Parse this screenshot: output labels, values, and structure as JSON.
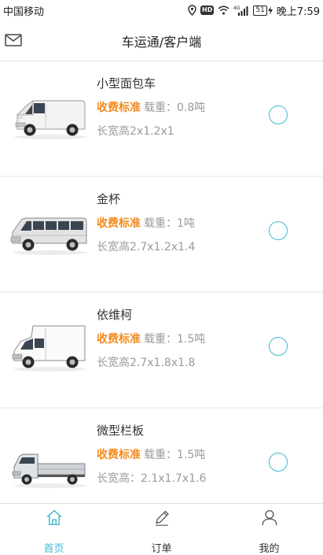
{
  "status_bar": {
    "carrier": "中国移动",
    "hd": "HD",
    "network": "4G",
    "battery": "51",
    "time": "晚上7:59"
  },
  "header": {
    "title": "车运通/客户端",
    "mail_icon": "mail-icon"
  },
  "vehicles": [
    {
      "name": "小型面包车",
      "fee_label": "收费标准",
      "load_label": "载重：",
      "load_value": "0.8吨",
      "dims": "长宽高2x1.2x1",
      "image": "minivan"
    },
    {
      "name": "金杯",
      "fee_label": "收费标准",
      "load_label": "载重：",
      "load_value": "1吨",
      "dims": "长宽高2.7x1.2x1.4",
      "image": "van"
    },
    {
      "name": "依维柯",
      "fee_label": "收费标准",
      "load_label": "载重：",
      "load_value": "1.5吨",
      "dims": "长宽高2.7x1.8x1.8",
      "image": "cargo-van"
    },
    {
      "name": "微型栏板",
      "fee_label": "收费标准",
      "load_label": "载重：",
      "load_value": "1.5吨",
      "dims": "长宽高：2.1x1.7x1.6",
      "image": "pickup-truck"
    }
  ],
  "tabs": [
    {
      "label": "首页",
      "icon": "home-icon",
      "active": true
    },
    {
      "label": "订单",
      "icon": "pencil-icon",
      "active": false
    },
    {
      "label": "我的",
      "icon": "user-icon",
      "active": false
    }
  ],
  "colors": {
    "accent": "#3fb8cf",
    "fee_link": "#f28a1e",
    "secondary_text": "#9a9a9a"
  }
}
